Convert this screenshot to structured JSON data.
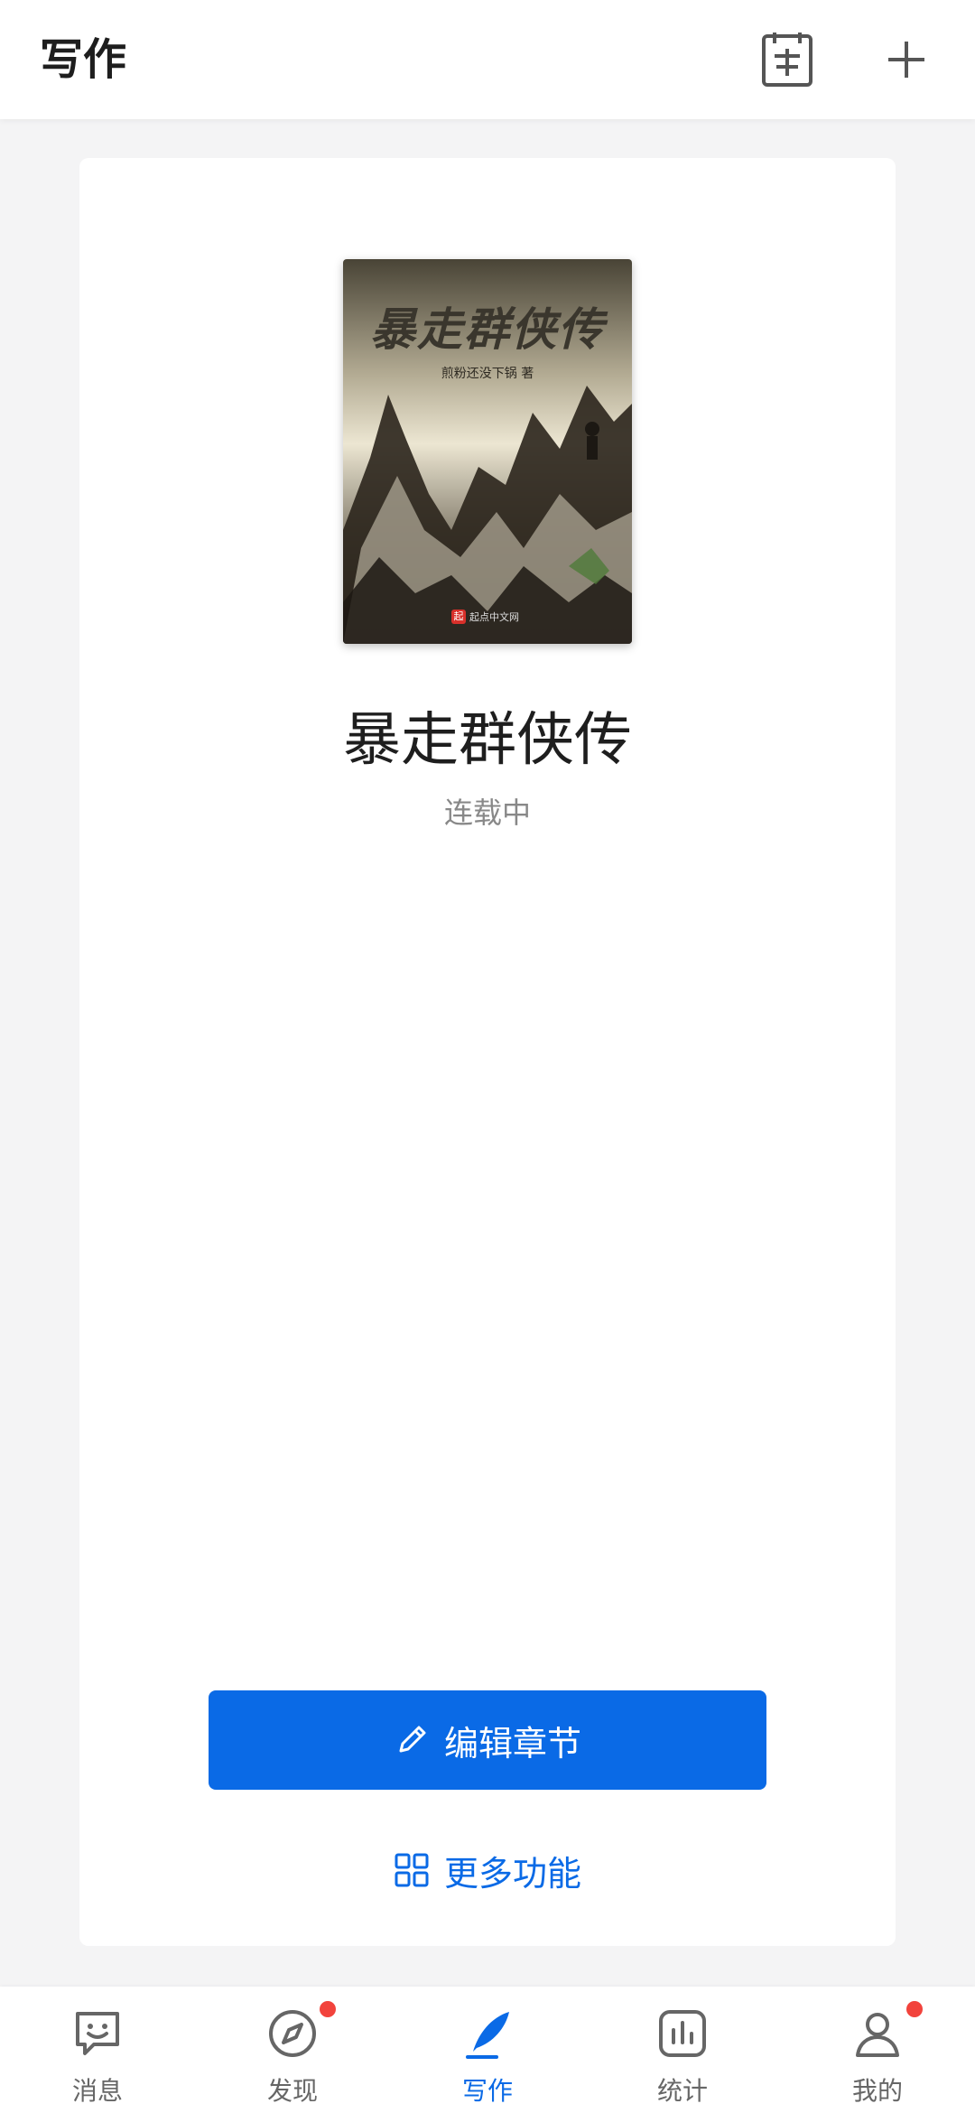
{
  "header": {
    "title": "写作",
    "calendar_icon": "calendar-sign-icon",
    "add_icon": "plus-icon"
  },
  "book": {
    "cover_title": "暴走群侠传",
    "cover_author": "煎粉还没下锅 著",
    "cover_publisher": "起点中文网",
    "title": "暴走群侠传",
    "status": "连载中"
  },
  "actions": {
    "edit_label": "编辑章节",
    "more_label": "更多功能"
  },
  "tabs": [
    {
      "label": "消息",
      "icon": "message-icon",
      "active": false,
      "dot": false
    },
    {
      "label": "发现",
      "icon": "compass-icon",
      "active": false,
      "dot": true
    },
    {
      "label": "写作",
      "icon": "quill-icon",
      "active": true,
      "dot": false
    },
    {
      "label": "统计",
      "icon": "chart-icon",
      "active": false,
      "dot": false
    },
    {
      "label": "我的",
      "icon": "profile-icon",
      "active": false,
      "dot": true
    }
  ],
  "colors": {
    "accent": "#0a6ae6",
    "badge_red": "#f2433c",
    "background": "#f4f4f5"
  }
}
